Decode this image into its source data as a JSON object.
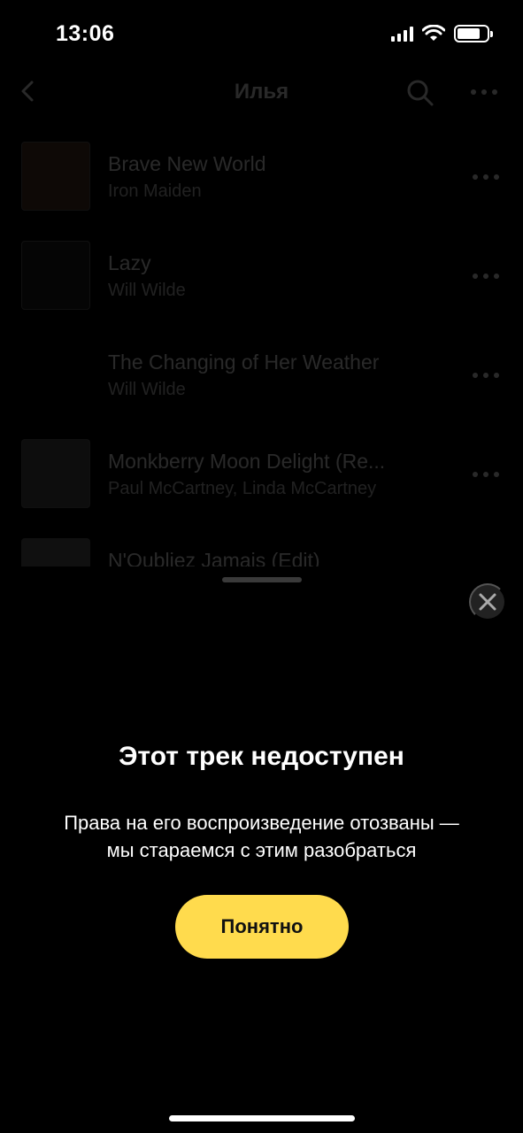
{
  "status_bar": {
    "time": "13:06"
  },
  "header": {
    "title": "Илья"
  },
  "tracks": [
    {
      "title": "Brave New World",
      "artist": "Iron Maiden"
    },
    {
      "title": "Lazy",
      "artist": "Will Wilde"
    },
    {
      "title": "The Changing of Her Weather",
      "artist": "Will Wilde"
    },
    {
      "title": "Monkberry Moon Delight (Re...",
      "artist": "Paul McCartney, Linda McCartney"
    },
    {
      "title": "N'Oubliez Jamais (Edit)",
      "artist": ""
    }
  ],
  "dialog": {
    "title": "Этот трек недоступен",
    "line1": "Права на его воспроизведение отозваны —",
    "line2": "мы стараемся с этим разобраться",
    "button_label": "Понятно"
  },
  "colors": {
    "accent": "#ffdb4d",
    "background": "#000000"
  }
}
